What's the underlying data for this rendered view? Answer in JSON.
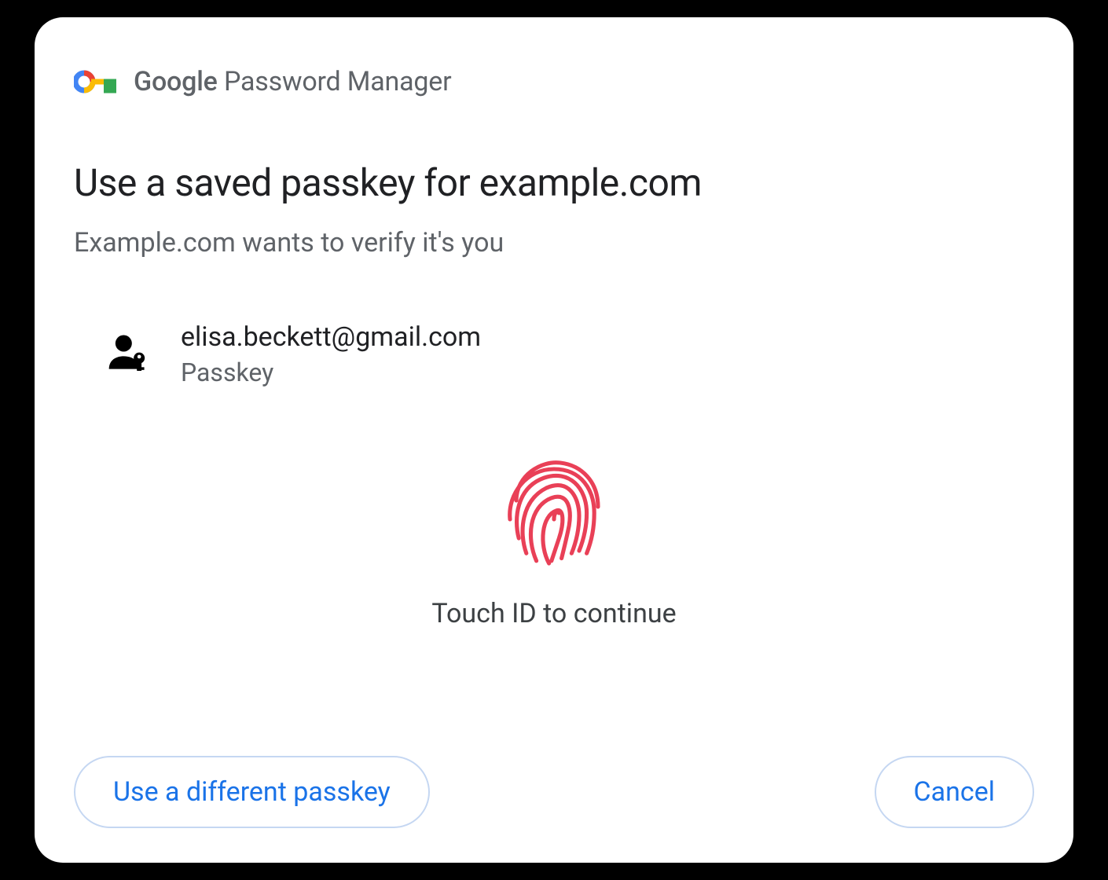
{
  "header": {
    "brand": "Google",
    "product": "Password Manager"
  },
  "title": "Use a saved passkey for example.com",
  "subtitle": "Example.com wants to verify it's you",
  "account": {
    "email": "elisa.beckett@gmail.com",
    "type": "Passkey"
  },
  "prompt": "Touch ID to continue",
  "buttons": {
    "alt": "Use a different passkey",
    "cancel": "Cancel"
  }
}
